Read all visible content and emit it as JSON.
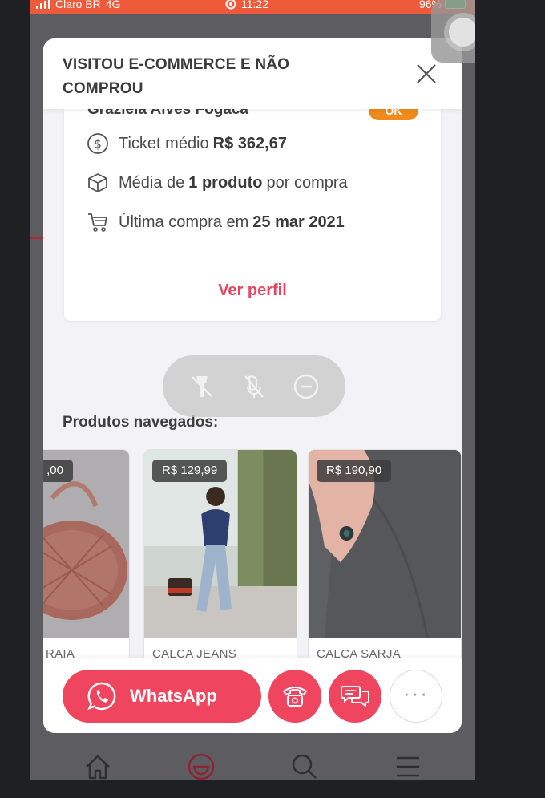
{
  "status_bar": {
    "carrier": "Claro BR",
    "network": "4G",
    "time": "11:22",
    "battery": "96%"
  },
  "modal": {
    "title": "VISITOU E-COMMERCE E NÃO COMPROU",
    "customer": {
      "name": "Graziela Alves Fogaca",
      "status_badge": "OK",
      "ticket_label": "Ticket médio",
      "ticket_value": "R$ 362,67",
      "media_prefix": "Média de",
      "media_value": "1 produto",
      "media_suffix": "por compra",
      "ultima_label": "Última compra em",
      "ultima_value": "25 mar 2021",
      "ver_perfil": "Ver perfil"
    },
    "produtos_label": "Produtos navegados:",
    "products": [
      {
        "price": ",00",
        "name": "RAIA"
      },
      {
        "price": "R$ 129,99",
        "name": "CALCA JEANS"
      },
      {
        "price": "R$ 190,90",
        "name": "CALCA SARJA"
      }
    ],
    "footer": {
      "whatsapp_label": "WhatsApp",
      "more_label": "···"
    }
  },
  "colors": {
    "accent": "#f0455f",
    "badge_ok": "#f08a1a",
    "status_bar": "#ef5a3a"
  }
}
